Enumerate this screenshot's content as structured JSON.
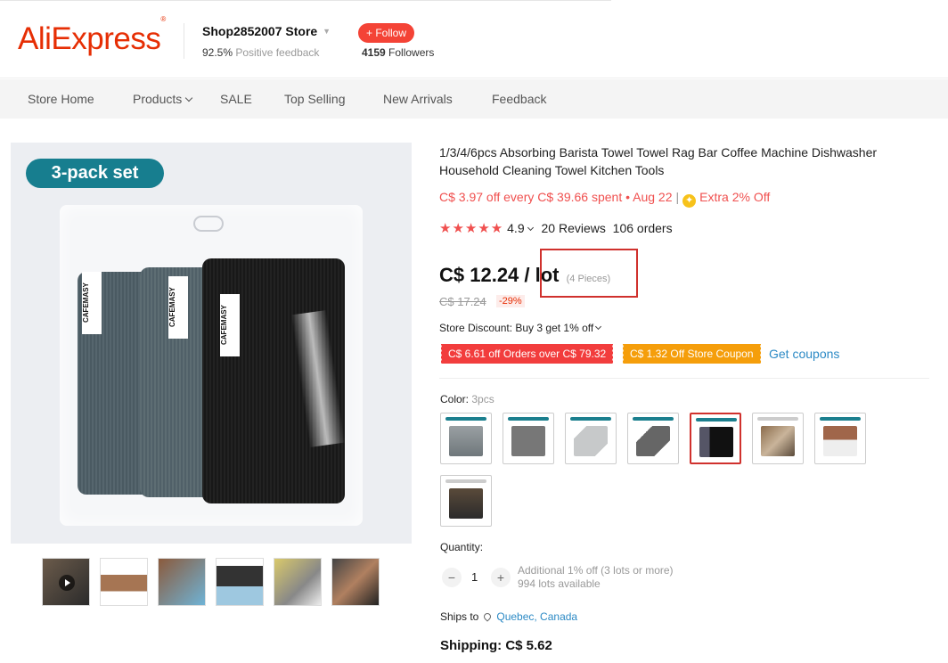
{
  "header": {
    "logo": "AliExpress",
    "store_name": "Shop2852007 Store",
    "feedback_percent": "92.5%",
    "feedback_label": "Positive feedback",
    "follow_label": "+ Follow",
    "followers_count": "4159",
    "followers_label": "Followers"
  },
  "nav": {
    "items": [
      "Store Home",
      "Products",
      "SALE",
      "Top Selling",
      "New Arrivals",
      "Feedback"
    ]
  },
  "gallery": {
    "badge": "3-pack set",
    "brand_tags": [
      "CAFEMASY",
      "CAFEMASY",
      "CAFEMASY"
    ],
    "thumbnail_count": 6
  },
  "product": {
    "title": "1/3/4/6pcs Absorbing Barista Towel Towel Rag Bar Coffee Machine Dishwasher Household Cleaning Towel Kitchen Tools",
    "promo_text": "C$ 3.97 off every C$ 39.66 spent • Aug 22",
    "promo_extra": "Extra 2% Off",
    "stars": "★★★★★",
    "rating": "4.9",
    "reviews": "20 Reviews",
    "orders": "106 orders",
    "price": "C$ 12.24 / lot",
    "pieces": "(4 Pieces)",
    "original_price": "C$ 17.24",
    "discount": "-29%",
    "store_discount": "Store Discount: Buy 3 get 1% off",
    "coupon_red": "C$ 6.61 off Orders over C$ 79.32",
    "coupon_orange": "C$ 1.32 Off Store Coupon",
    "get_coupons": "Get coupons",
    "color_label": "Color:",
    "color_value": "3pcs",
    "swatch_count": 8,
    "selected_swatch": 5,
    "quantity_label": "Quantity:",
    "quantity_value": "1",
    "qty_minus": "−",
    "qty_plus": "+",
    "qty_info_1": "Additional 1% off (3 lots or more)",
    "qty_info_2": "994 lots available",
    "ships_to_label": "Ships to",
    "ships_to_location": "Quebec, Canada",
    "shipping": "Shipping: C$ 5.62"
  },
  "colors": {
    "brand_red": "#e62e04",
    "promo_red": "#f0504f",
    "link_blue": "#2c8ac5",
    "badge_teal": "#177e8f",
    "coupon_orange": "#f59e0b"
  }
}
